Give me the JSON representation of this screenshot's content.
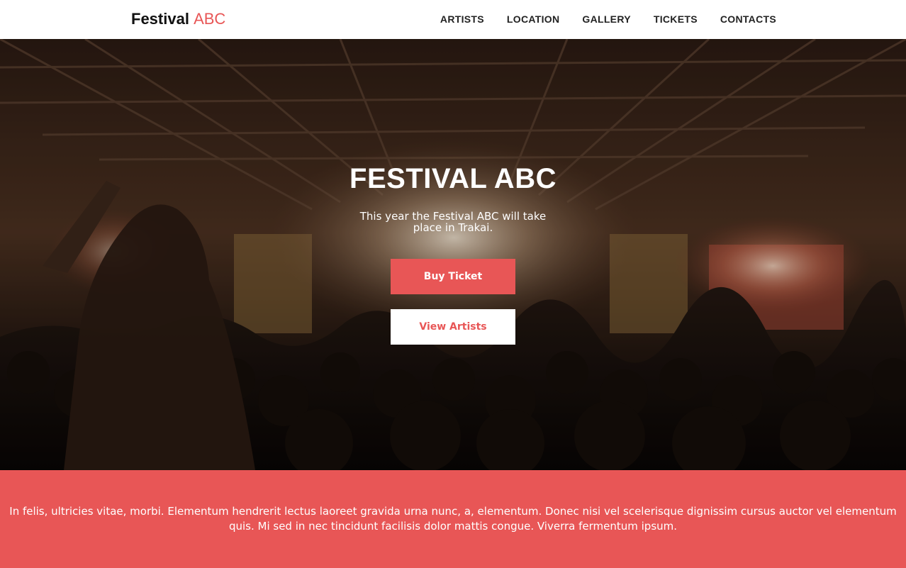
{
  "brand": {
    "name": "Festival",
    "accent": "ABC",
    "accent_color": "#e85656"
  },
  "nav": {
    "items": [
      {
        "label": "ARTISTS"
      },
      {
        "label": "LOCATION"
      },
      {
        "label": "GALLERY"
      },
      {
        "label": "TICKETS"
      },
      {
        "label": "CONTACTS"
      }
    ]
  },
  "hero": {
    "title": "FESTIVAL ABC",
    "subtitle": "This year the Festival ABC will take place in Trakai.",
    "buy_label": "Buy Ticket",
    "view_label": "View Artists"
  },
  "band": {
    "text": "In felis, ultricies vitae, morbi. Elementum hendrerit lectus laoreet gravida urna nunc, a, elementum. Donec nisi vel scelerisque dignissim cursus auctor vel elementum quis. Mi sed in nec tincidunt facilisis dolor mattis congue. Viverra fermentum ipsum.",
    "color": "#e85656"
  }
}
